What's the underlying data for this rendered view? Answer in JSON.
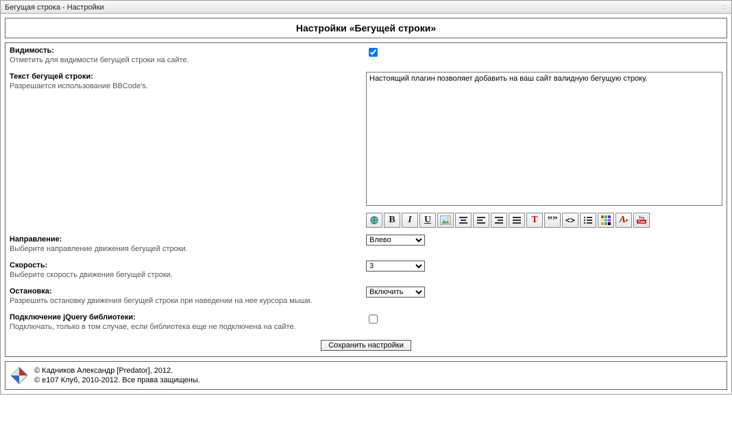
{
  "window": {
    "title": "Бегущая строка - Настройки"
  },
  "header": {
    "title": "Настройки «Бегущей строки»"
  },
  "fields": {
    "visibility": {
      "label": "Видимость:",
      "desc": "Отметить для видимости бегущей строки на сайте.",
      "checked": true
    },
    "text": {
      "label": "Текст бегущей строки:",
      "desc": "Разрешается использование BBCode's.",
      "value": "Настоящий плагин позволяет добавить на ваш сайт валидную бегущую строку."
    },
    "direction": {
      "label": "Направление:",
      "desc": "Выберите направление движения бегущей строки.",
      "value": "Влево"
    },
    "speed": {
      "label": "Скорость:",
      "desc": "Выберите скорость движения бегущей строки.",
      "value": "3"
    },
    "stop": {
      "label": "Остановка:",
      "desc": "Разрешить остановку движения бегущей строки при наведении на нее курсора мыши.",
      "value": "Включить"
    },
    "jquery": {
      "label": "Подключение jQuery библиотеки:",
      "desc": "Подключать, только в том случае, если библиотека еще не подключена на сайте.",
      "checked": false
    }
  },
  "toolbar": {
    "items": [
      "link-icon",
      "bold-icon",
      "italic-icon",
      "underline-icon",
      "image-icon",
      "align-center-icon",
      "align-left-icon",
      "align-right-icon",
      "align-justify-icon",
      "text-style-icon",
      "quote-icon",
      "code-icon",
      "list-icon",
      "color-icon",
      "font-icon",
      "youtube-icon"
    ]
  },
  "actions": {
    "save": "Сохранить настройки"
  },
  "footer": {
    "line1": "© Кадников Александр [Predator], 2012.",
    "line2": "© e107 Клуб, 2010-2012. Все права защищены."
  }
}
